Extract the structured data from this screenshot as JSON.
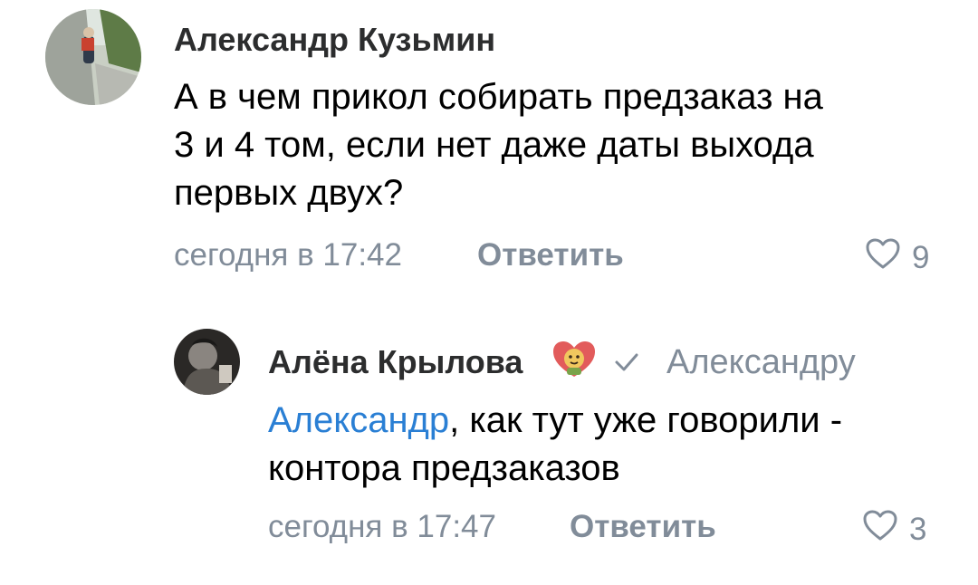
{
  "comments": [
    {
      "author": "Александр Кузьмин",
      "text_lines": [
        "А в чем прикол собирать предзаказ на",
        "3 и 4 том, если нет даже даты выхода",
        "первых двух?"
      ],
      "timestamp": "сегодня в 17:42",
      "reply_label": "Ответить",
      "likes": "9"
    }
  ],
  "reply": {
    "author": "Алёна Крылова",
    "reply_to": "Александру",
    "mention": "Александр",
    "text_line1_rest": ", как тут уже говорили -",
    "text_line2": "контора предзаказов",
    "timestamp": "сегодня в 17:47",
    "reply_label": "Ответить",
    "likes": "3"
  },
  "colors": {
    "secondary_text": "#818c99",
    "mention": "#2a7fd4",
    "author": "#2c2d2e",
    "badge_heart": "#e25b5b"
  },
  "icons": {
    "like": "heart-outline-icon",
    "reply_arrow": "checkmark-reply-icon",
    "author_badge": "heart-lion-sticker-icon"
  }
}
